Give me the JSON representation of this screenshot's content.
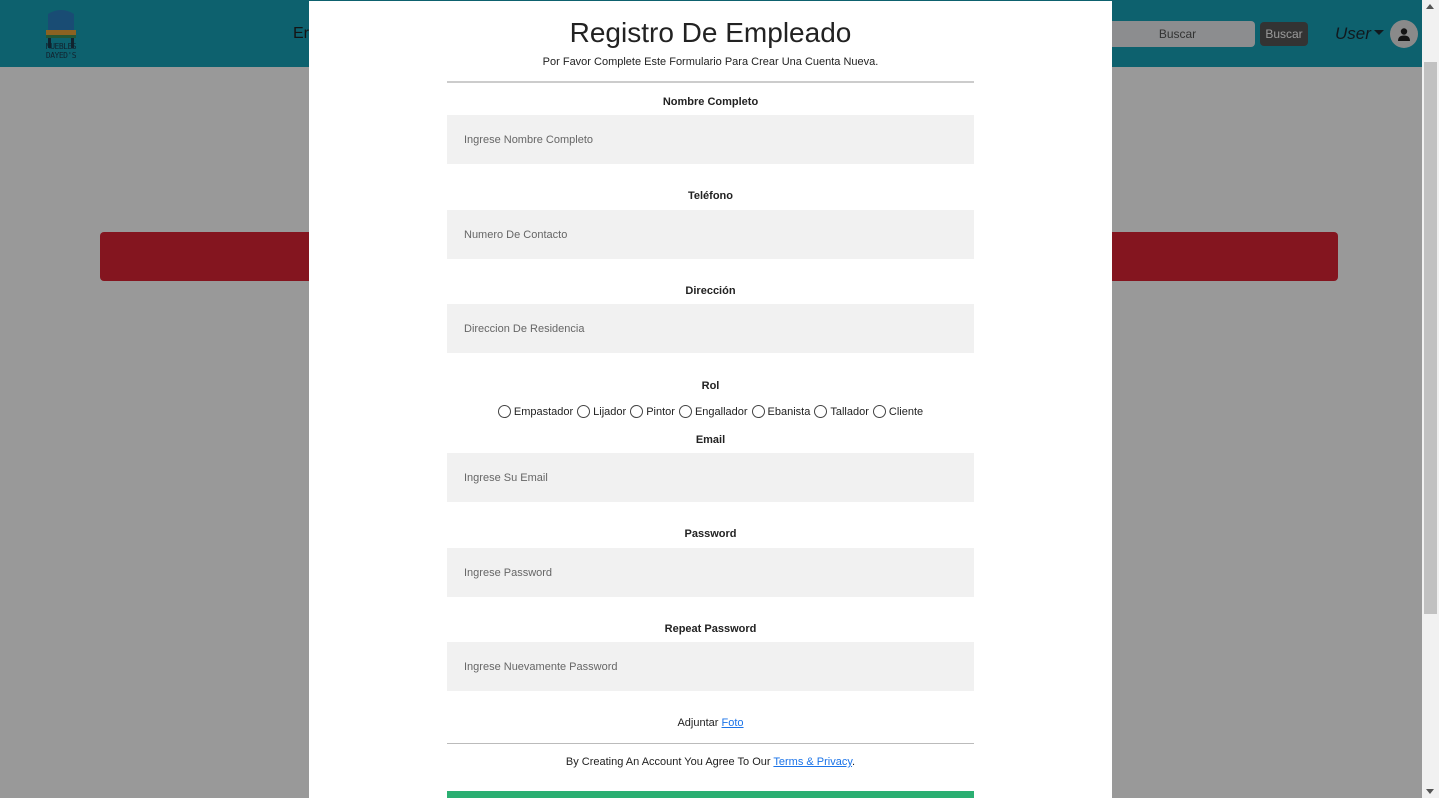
{
  "navbar": {
    "logo_text": "MUEBLES DAYED'S",
    "nav_fragment": "Er",
    "search_placeholder": "Buscar",
    "search_button": "Buscar",
    "user_label": "User",
    "accent_color": "#17a2b8"
  },
  "alert": {
    "color": "#dc2434"
  },
  "modal": {
    "title": "Registro De Empleado",
    "subtitle": "Por Favor Complete Este Formulario Para Crear Una Cuenta Nueva.",
    "fields": {
      "name": {
        "label": "Nombre Completo",
        "placeholder": "Ingrese Nombre Completo"
      },
      "phone": {
        "label": "Teléfono",
        "placeholder": "Numero De Contacto"
      },
      "address": {
        "label": "Dirección",
        "placeholder": "Direccion De Residencia"
      },
      "email": {
        "label": "Email",
        "placeholder": "Ingrese Su Email"
      },
      "password": {
        "label": "Password",
        "placeholder": "Ingrese Password"
      },
      "password2": {
        "label": "Repeat Password",
        "placeholder": "Ingrese Nuevamente Password"
      }
    },
    "role_label": "Rol",
    "roles": [
      "Empastador",
      "Lijador",
      "Pintor",
      "Engallador",
      "Ebanista",
      "Tallador",
      "Cliente"
    ],
    "attach_prefix": "Adjuntar",
    "attach_link": "Foto",
    "terms_prefix": "By Creating An Account You Agree To Our",
    "terms_link": "Terms & Privacy",
    "terms_suffix": ".",
    "submit_color": "#2baf72"
  }
}
